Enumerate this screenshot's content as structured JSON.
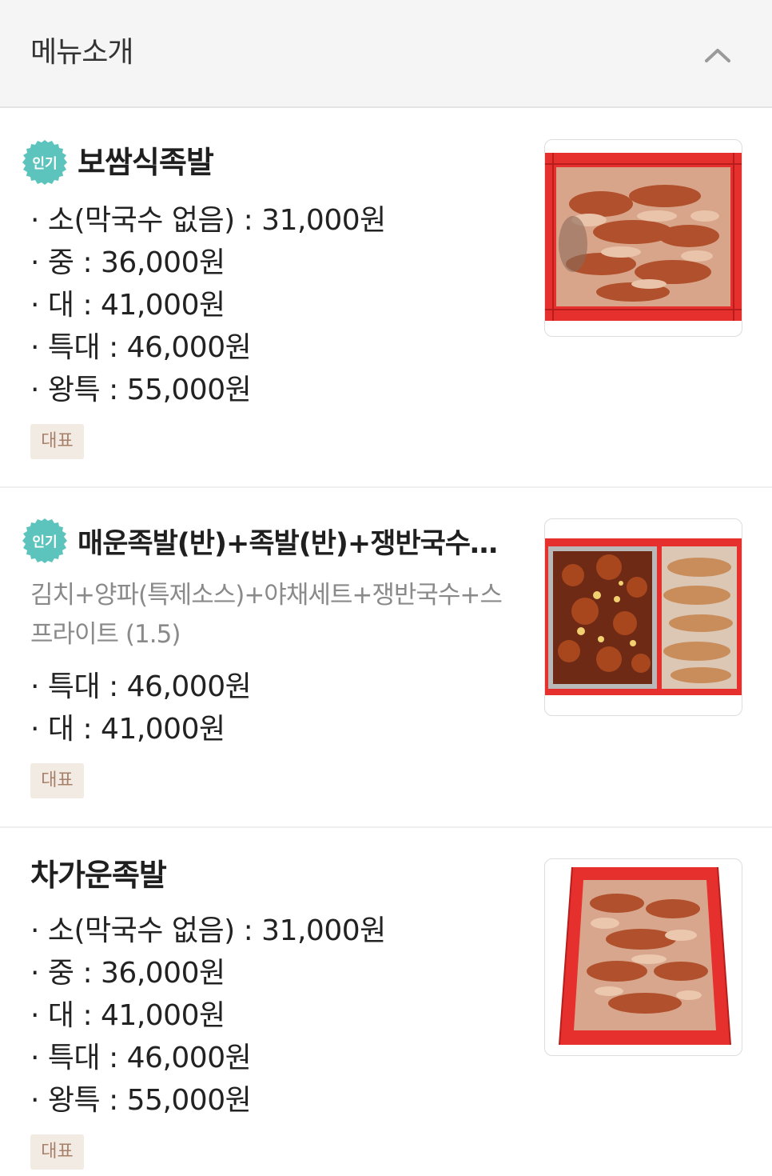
{
  "header": {
    "title": "메뉴소개",
    "collapse_icon": "chevron-up-icon"
  },
  "colors": {
    "popular_badge": "#5cc4bd",
    "tag_bg": "#f2ebe3",
    "tag_text": "#a8806a",
    "basket_red": "#e5302e"
  },
  "menu": {
    "items": [
      {
        "badge": "인기",
        "name": "보쌈식족발",
        "prices": [
          "소(막국수 없음) : 31,000원",
          "중 : 36,000원",
          "대 : 41,000원",
          "특대 : 46,000원",
          "왕특 : 55,000원"
        ],
        "tag": "대표"
      },
      {
        "badge": "인기",
        "name": "매운족발(반)+족발(반)+쟁반국수…",
        "description": "김치+양파(특제소스)+야채세트+쟁반국수+스프라이트 (1.5)",
        "prices": [
          "특대 : 46,000원",
          "대 : 41,000원"
        ],
        "tag": "대표"
      },
      {
        "name": "차가운족발",
        "prices": [
          "소(막국수 없음) : 31,000원",
          "중 : 36,000원",
          "대 : 41,000원",
          "특대 : 46,000원",
          "왕특 : 55,000원"
        ],
        "tag": "대표"
      }
    ]
  }
}
